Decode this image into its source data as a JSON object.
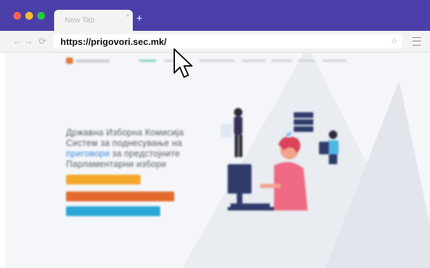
{
  "browser": {
    "tab_title": "New Tab",
    "tab_close": "×",
    "new_tab": "+",
    "back": "←",
    "forward": "→",
    "reload": "⟳",
    "url": "https://prigovori.sec.mk/",
    "bookmark": "☆"
  },
  "page": {
    "hero": {
      "line1": "Државна Изборна Комисија",
      "line2": "Систем за поднесување на",
      "line3_accent": "приговори",
      "line3_rest": " за предстојните",
      "line4": "Парламентарни избори"
    },
    "buttons": [
      "",
      "",
      ""
    ]
  },
  "colors": {
    "chrome": "#4a3fa8",
    "accent_blue": "#3a86d8",
    "btn_yellow": "#f3a62a",
    "btn_orange": "#e26a2c",
    "btn_cyan": "#2aa7d6"
  }
}
